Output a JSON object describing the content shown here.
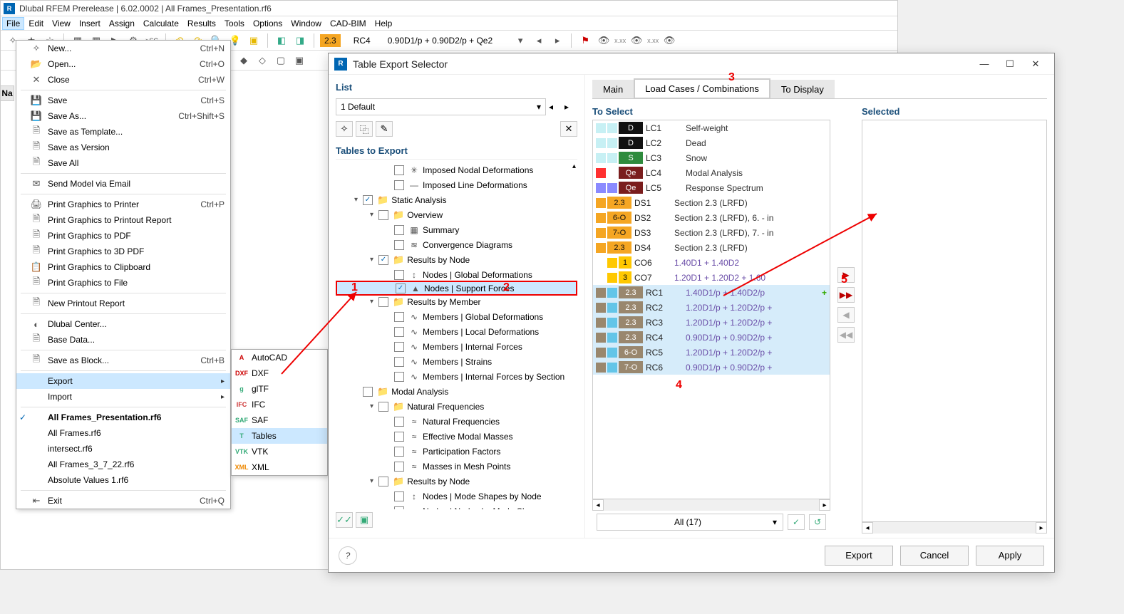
{
  "app": {
    "title": "Dlubal RFEM Prerelease | 6.02.0002 | All Frames_Presentation.rf6",
    "menubar": [
      "File",
      "Edit",
      "View",
      "Insert",
      "Assign",
      "Calculate",
      "Results",
      "Tools",
      "Options",
      "Window",
      "CAD-BIM",
      "Help"
    ],
    "active_menu_index": 0,
    "combo_bar": {
      "ver": "2.3",
      "rc": "RC4",
      "desc": "0.90D1/p + 0.90D2/p + Qe2"
    }
  },
  "nav_label": "Na",
  "file_menu": [
    {
      "icon": "✧",
      "label": "New...",
      "shortcut": "Ctrl+N"
    },
    {
      "icon": "📂",
      "label": "Open...",
      "shortcut": "Ctrl+O"
    },
    {
      "icon": "✕",
      "label": "Close",
      "shortcut": "Ctrl+W"
    },
    {
      "sep": true
    },
    {
      "icon": "💾",
      "label": "Save",
      "shortcut": "Ctrl+S"
    },
    {
      "icon": "💾",
      "label": "Save As...",
      "shortcut": "Ctrl+Shift+S"
    },
    {
      "icon": "🗎",
      "label": "Save as Template..."
    },
    {
      "icon": "🗎",
      "label": "Save as Version"
    },
    {
      "icon": "🗎",
      "label": "Save All"
    },
    {
      "sep": true
    },
    {
      "icon": "✉",
      "label": "Send Model via Email"
    },
    {
      "sep": true
    },
    {
      "icon": "🖨",
      "label": "Print Graphics to Printer",
      "shortcut": "Ctrl+P"
    },
    {
      "icon": "🗎",
      "label": "Print Graphics to Printout Report"
    },
    {
      "icon": "🗎",
      "label": "Print Graphics to PDF"
    },
    {
      "icon": "🗎",
      "label": "Print Graphics to 3D PDF"
    },
    {
      "icon": "📋",
      "label": "Print Graphics to Clipboard"
    },
    {
      "icon": "🗎",
      "label": "Print Graphics to File"
    },
    {
      "sep": true
    },
    {
      "icon": "🗎",
      "label": "New Printout Report"
    },
    {
      "sep": true
    },
    {
      "icon": "◐",
      "label": "Dlubal Center..."
    },
    {
      "icon": "🗎",
      "label": "Base Data..."
    },
    {
      "sep": true
    },
    {
      "icon": "🗎",
      "label": "Save as Block...",
      "shortcut": "Ctrl+B"
    },
    {
      "sep": true
    },
    {
      "icon": "",
      "label": "Export",
      "hasSub": true,
      "highlight": true
    },
    {
      "icon": "",
      "label": "Import",
      "hasSub": true
    },
    {
      "sep": true
    },
    {
      "icon": "",
      "label": "All Frames_Presentation.rf6",
      "checked": true,
      "bold": true
    },
    {
      "icon": "",
      "label": "All Frames.rf6"
    },
    {
      "icon": "",
      "label": "intersect.rf6"
    },
    {
      "icon": "",
      "label": "All Frames_3_7_22.rf6"
    },
    {
      "icon": "",
      "label": "Absolute Values 1.rf6"
    },
    {
      "sep": true
    },
    {
      "icon": "⇤",
      "label": "Exit",
      "shortcut": "Ctrl+Q"
    }
  ],
  "export_menu": [
    {
      "icon": "A",
      "label": "AutoCAD",
      "icolor": "#c00"
    },
    {
      "icon": "DXF",
      "label": "DXF",
      "icolor": "#c00"
    },
    {
      "icon": "g",
      "label": "glTF",
      "icolor": "#3a7"
    },
    {
      "icon": "IFC",
      "label": "IFC",
      "icolor": "#c33"
    },
    {
      "icon": "SAF",
      "label": "SAF",
      "icolor": "#3a7"
    },
    {
      "icon": "T",
      "label": "Tables",
      "highlight": true,
      "icolor": "#3a7"
    },
    {
      "icon": "VTK",
      "label": "VTK",
      "icolor": "#3a7"
    },
    {
      "icon": "XML",
      "label": "XML",
      "icolor": "#e80"
    }
  ],
  "dialog": {
    "title": "Table Export Selector",
    "list_section": "List",
    "list_value": "1  Default",
    "tables_section": "Tables to Export",
    "tree": [
      {
        "level": 3,
        "chk": false,
        "ic": "✳",
        "label": "Imposed Nodal Deformations"
      },
      {
        "level": 3,
        "chk": false,
        "ic": "—",
        "label": "Imposed Line Deformations"
      },
      {
        "level": 1,
        "caret": "▾",
        "chk": true,
        "folder": true,
        "label": "Static Analysis"
      },
      {
        "level": 2,
        "caret": "▾",
        "chk": false,
        "folder": true,
        "label": "Overview"
      },
      {
        "level": 3,
        "chk": false,
        "ic": "▦",
        "label": "Summary"
      },
      {
        "level": 3,
        "chk": false,
        "ic": "≋",
        "label": "Convergence Diagrams"
      },
      {
        "level": 2,
        "caret": "▾",
        "chk": true,
        "folder": true,
        "label": "Results by Node"
      },
      {
        "level": 3,
        "chk": false,
        "ic": "↕",
        "label": "Nodes | Global Deformations"
      },
      {
        "level": 3,
        "chk": true,
        "ic": "▲",
        "label": "Nodes | Support Forces",
        "selected": true,
        "redbox": true
      },
      {
        "level": 2,
        "caret": "▾",
        "chk": false,
        "folder": true,
        "label": "Results by Member"
      },
      {
        "level": 3,
        "chk": false,
        "ic": "∿",
        "label": "Members | Global Deformations"
      },
      {
        "level": 3,
        "chk": false,
        "ic": "∿",
        "label": "Members | Local Deformations"
      },
      {
        "level": 3,
        "chk": false,
        "ic": "∿",
        "label": "Members | Internal Forces"
      },
      {
        "level": 3,
        "chk": false,
        "ic": "∿",
        "label": "Members | Strains"
      },
      {
        "level": 3,
        "chk": false,
        "ic": "∿",
        "label": "Members | Internal Forces by Section"
      },
      {
        "level": 1,
        "caret": "",
        "chk": false,
        "folder": true,
        "label": "Modal Analysis"
      },
      {
        "level": 2,
        "caret": "▾",
        "chk": false,
        "folder": true,
        "label": "Natural Frequencies"
      },
      {
        "level": 3,
        "chk": false,
        "ic": "≈",
        "label": "Natural Frequencies"
      },
      {
        "level": 3,
        "chk": false,
        "ic": "≈",
        "label": "Effective Modal Masses"
      },
      {
        "level": 3,
        "chk": false,
        "ic": "≈",
        "label": "Participation Factors"
      },
      {
        "level": 3,
        "chk": false,
        "ic": "≈",
        "label": "Masses in Mesh Points"
      },
      {
        "level": 2,
        "caret": "▾",
        "chk": false,
        "folder": true,
        "label": "Results by Node"
      },
      {
        "level": 3,
        "chk": false,
        "ic": "↕",
        "label": "Nodes | Mode Shapes by Node"
      },
      {
        "level": 3,
        "chk": false,
        "ic": "↕",
        "label": "Nodes | Nodes by Mode Shape"
      }
    ],
    "tabs": [
      "Main",
      "Load Cases / Combinations",
      "To Display"
    ],
    "active_tab": 1,
    "to_select_title": "To Select",
    "selected_title": "Selected",
    "to_select": [
      {
        "sw1": "#c7f0f4",
        "sw2": "#c7f0f4",
        "tagClass": "black",
        "tag": "D",
        "code": "LC1",
        "desc": "Self-weight"
      },
      {
        "sw1": "#c7f0f4",
        "sw2": "#c7f0f4",
        "tagClass": "black",
        "tag": "D",
        "code": "LC2",
        "desc": "Dead"
      },
      {
        "sw1": "#c7f0f4",
        "sw2": "#c7f0f4",
        "tagClass": "green",
        "tag": "S",
        "code": "LC3",
        "desc": "Snow"
      },
      {
        "sw1": "#ff3030",
        "sw2": "#ffffff",
        "tagClass": "darkred",
        "tag": "Qe",
        "code": "LC4",
        "desc": "Modal Analysis"
      },
      {
        "sw1": "#8a8aff",
        "sw2": "#8a8aff",
        "tagClass": "darkred",
        "tag": "Qe",
        "code": "LC5",
        "desc": "Response Spectrum"
      },
      {
        "sw1": "#f5a623",
        "tagClass": "orange",
        "tag": "2.3",
        "code": "DS1",
        "desc": "Section 2.3 (LRFD)"
      },
      {
        "sw1": "#f5a623",
        "tagClass": "orange",
        "tag": "6-O",
        "code": "DS2",
        "desc": "Section 2.3 (LRFD), 6. - in"
      },
      {
        "sw1": "#f5a623",
        "tagClass": "orange",
        "tag": "7-O",
        "code": "DS3",
        "desc": "Section 2.3 (LRFD), 7. - in"
      },
      {
        "sw1": "#f5a623",
        "tagClass": "orange",
        "tag": "2.3",
        "code": "DS4",
        "desc": "Section 2.3 (LRFD)"
      },
      {
        "sw1": "#ffffff",
        "sw2": "#ffc800",
        "tagClass": "yellowbox",
        "tag": "1",
        "code": "CO6",
        "desc": "1.40D1 + 1.40D2",
        "link": true
      },
      {
        "sw1": "#ffffff",
        "sw2": "#ffc800",
        "tagClass": "yellowbox",
        "tag": "3",
        "code": "CO7",
        "desc": "1.20D1 + 1.20D2 + 1.60",
        "link": true
      },
      {
        "sel": true,
        "sw1": "#99876e",
        "sw2": "#63c5e8",
        "tagClass": "brown",
        "tag": "2.3",
        "code": "RC1",
        "desc": "1.40D1/p + 1.40D2/p",
        "link": true,
        "plus": true
      },
      {
        "sel": true,
        "sw1": "#99876e",
        "sw2": "#63c5e8",
        "tagClass": "brown",
        "tag": "2.3",
        "code": "RC2",
        "desc": "1.20D1/p + 1.20D2/p +",
        "link": true
      },
      {
        "sel": true,
        "sw1": "#99876e",
        "sw2": "#63c5e8",
        "tagClass": "brown",
        "tag": "2.3",
        "code": "RC3",
        "desc": "1.20D1/p + 1.20D2/p +",
        "link": true
      },
      {
        "sel": true,
        "sw1": "#99876e",
        "sw2": "#63c5e8",
        "tagClass": "brown",
        "tag": "2.3",
        "code": "RC4",
        "desc": "0.90D1/p + 0.90D2/p +",
        "link": true
      },
      {
        "sel": true,
        "sw1": "#99876e",
        "sw2": "#63c5e8",
        "tagClass": "brown",
        "tag": "6-O",
        "code": "RC5",
        "desc": "1.20D1/p + 1.20D2/p +",
        "link": true
      },
      {
        "sel": true,
        "sw1": "#99876e",
        "sw2": "#63c5e8",
        "tagClass": "brown",
        "tag": "7-O",
        "code": "RC6",
        "desc": "0.90D1/p + 0.90D2/p +",
        "link": true
      }
    ],
    "filter": "All (17)",
    "footer": {
      "export": "Export",
      "cancel": "Cancel",
      "apply": "Apply"
    }
  },
  "annotations": {
    "n1": "1",
    "n2": "2",
    "n3": "3",
    "n4": "4",
    "n5": "5"
  }
}
